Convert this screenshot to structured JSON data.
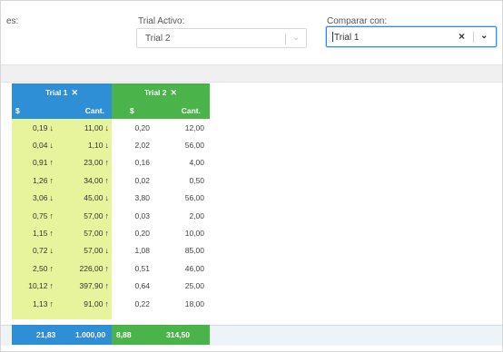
{
  "filters": {
    "left_label_fragment": "es:",
    "trial_activo": {
      "label": "Trial Activo:",
      "value": "Trial 2"
    },
    "comparar_con": {
      "label": "Comparar con:",
      "value": "Trial 1"
    }
  },
  "table": {
    "trial1": {
      "title": "Trial 1",
      "close": "✕",
      "col_money": "$",
      "col_qty": "Cant."
    },
    "trial2": {
      "title": "Trial 2",
      "close": "✕",
      "col_money": "$",
      "col_qty": "Cant."
    },
    "rows": [
      {
        "t1_money": "0,19",
        "t1_money_dir": "down",
        "t1_qty": "11,00",
        "t1_qty_dir": "down",
        "t2_money": "0,20",
        "t2_qty": "12,00"
      },
      {
        "t1_money": "0,04",
        "t1_money_dir": "down",
        "t1_qty": "1,10",
        "t1_qty_dir": "down",
        "t2_money": "2,02",
        "t2_qty": "56,00"
      },
      {
        "t1_money": "0,91",
        "t1_money_dir": "up",
        "t1_qty": "23,00",
        "t1_qty_dir": "up",
        "t2_money": "0,16",
        "t2_qty": "4,00"
      },
      {
        "t1_money": "1,26",
        "t1_money_dir": "up",
        "t1_qty": "34,00",
        "t1_qty_dir": "up",
        "t2_money": "0,02",
        "t2_qty": "0,50"
      },
      {
        "t1_money": "3,06",
        "t1_money_dir": "down",
        "t1_qty": "45,00",
        "t1_qty_dir": "down",
        "t2_money": "3,80",
        "t2_qty": "56,00"
      },
      {
        "t1_money": "0,75",
        "t1_money_dir": "up",
        "t1_qty": "57,00",
        "t1_qty_dir": "up",
        "t2_money": "0,03",
        "t2_qty": "2,00"
      },
      {
        "t1_money": "1,15",
        "t1_money_dir": "up",
        "t1_qty": "57,00",
        "t1_qty_dir": "up",
        "t2_money": "0,20",
        "t2_qty": "10,00"
      },
      {
        "t1_money": "0,72",
        "t1_money_dir": "down",
        "t1_qty": "57,00",
        "t1_qty_dir": "down",
        "t2_money": "1,08",
        "t2_qty": "85,00"
      },
      {
        "t1_money": "2,50",
        "t1_money_dir": "up",
        "t1_qty": "226,00",
        "t1_qty_dir": "up",
        "t2_money": "0,51",
        "t2_qty": "46,00"
      },
      {
        "t1_money": "10,12",
        "t1_money_dir": "up",
        "t1_qty": "397,90",
        "t1_qty_dir": "up",
        "t2_money": "0,64",
        "t2_qty": "25,00"
      },
      {
        "t1_money": "1,13",
        "t1_money_dir": "up",
        "t1_qty": "91,00",
        "t1_qty_dir": "up",
        "t2_money": "0,22",
        "t2_qty": "18,00"
      }
    ],
    "totals": {
      "t1_money": "21,83",
      "t1_qty": "1.000,00",
      "t2_money": "8,88",
      "t2_qty": "314,50"
    }
  },
  "icons": {
    "up": "arrow-up-icon",
    "down": "arrow-down-icon",
    "chevron": "chevron-down-icon",
    "clear": "clear-icon"
  },
  "colors": {
    "trial1": "#2e8ed6",
    "trial2": "#4ab44a",
    "highlight": "#e8f49c",
    "focus": "#2d8cf0"
  }
}
